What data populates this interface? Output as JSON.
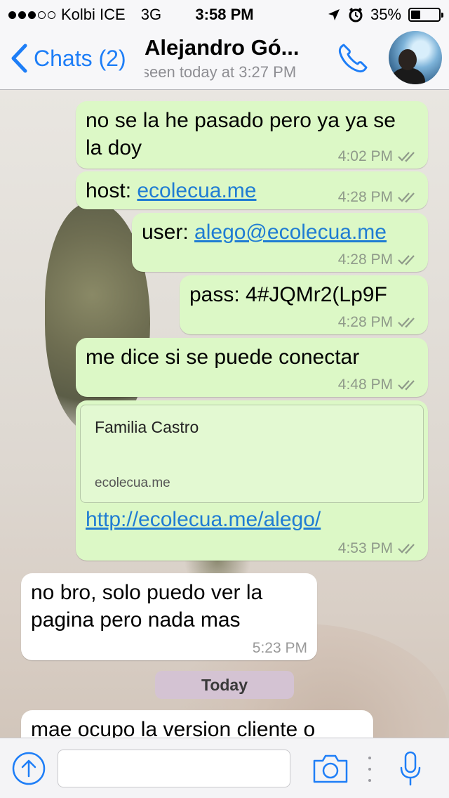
{
  "status_bar": {
    "carrier": "Kolbi ICE",
    "network": "3G",
    "time": "3:58 PM",
    "battery": "35%",
    "battery_level": 0.35,
    "signal_bars": 3
  },
  "header": {
    "back_label": "Chats (2)",
    "contact_name": "Alejandro Gó...",
    "last_seen": "seen today at 3:27 PM"
  },
  "messages": [
    {
      "direction": "out",
      "text": "no se la he pasado pero ya ya se la doy",
      "time": "4:02 PM"
    },
    {
      "direction": "out",
      "prefix": "host: ",
      "link": "ecolecua.me",
      "time": "4:28 PM"
    },
    {
      "direction": "out",
      "prefix": "user: ",
      "link": "alego@ecolecua.me",
      "time": "4:28 PM"
    },
    {
      "direction": "out",
      "text": "pass: 4#JQMr2(Lp9F",
      "time": "4:28 PM"
    },
    {
      "direction": "out",
      "text": "me dice si se puede conectar",
      "time": "4:48 PM"
    },
    {
      "direction": "out",
      "preview_title": "Familia Castro",
      "preview_domain": "ecolecua.me",
      "link": "http://ecolecua.me/alego/",
      "time": "4:53 PM"
    },
    {
      "direction": "in",
      "text": "no bro, solo puedo ver la pagina pero nada mas",
      "time": "5:23 PM"
    },
    {
      "direction": "in",
      "text": "mae ocupo la version cliente o"
    }
  ],
  "date_divider": "Today",
  "input": {
    "value": "",
    "placeholder": ""
  },
  "colors": {
    "accent": "#1e7ef7",
    "outgoing_bubble": "#dcf8c6",
    "incoming_bubble": "#ffffff",
    "link": "#1f7cd3"
  },
  "icons": [
    "back-chevron-icon",
    "phone-icon",
    "upload-icon",
    "camera-icon",
    "microphone-icon",
    "double-check-icon",
    "location-arrow-icon",
    "alarm-icon"
  ]
}
